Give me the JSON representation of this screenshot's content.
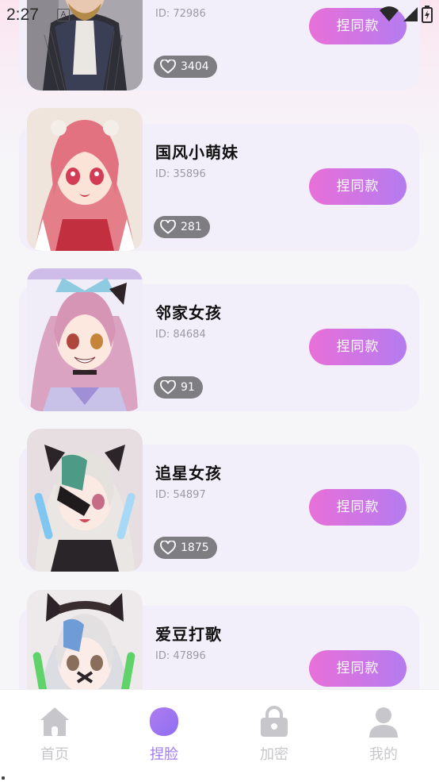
{
  "status_bar": {
    "time": "2:27",
    "notification_icon": "A",
    "icons": [
      "wifi-icon",
      "signal-icon",
      "battery-icon"
    ]
  },
  "accent": {
    "button_gradient": [
      "#e96fd8",
      "#b47cf0"
    ],
    "active_tab": "#a07cf0",
    "inactive_tab": "#c7c7cb",
    "like_pill": "#7d7d82"
  },
  "cards": [
    {
      "name": "",
      "id_text": "ID: 72986",
      "likes": "3404",
      "button_label": "捏同款",
      "avatar_icon": "avatar-man-portrait"
    },
    {
      "name": "国风小萌妹",
      "id_text": "ID: 35896",
      "likes": "281",
      "button_label": "捏同款",
      "avatar_icon": "avatar-pink-hair-girl"
    },
    {
      "name": "邻家女孩",
      "id_text": "ID: 84684",
      "likes": "91",
      "button_label": "捏同款",
      "avatar_icon": "avatar-sailor-girl"
    },
    {
      "name": "追星女孩",
      "id_text": "ID: 54897",
      "likes": "1875",
      "button_label": "捏同款",
      "avatar_icon": "avatar-eyepatch-girl"
    },
    {
      "name": "爱豆打歌",
      "id_text": "ID: 47896",
      "likes": "",
      "button_label": "捏同款",
      "avatar_icon": "avatar-cat-ear-girl"
    }
  ],
  "tabbar": {
    "tabs": [
      {
        "label": "首页",
        "icon": "home-icon",
        "active": false
      },
      {
        "label": "捏脸",
        "icon": "face-icon",
        "active": true
      },
      {
        "label": "加密",
        "icon": "lock-icon",
        "active": false
      },
      {
        "label": "我的",
        "icon": "user-icon",
        "active": false
      }
    ]
  }
}
